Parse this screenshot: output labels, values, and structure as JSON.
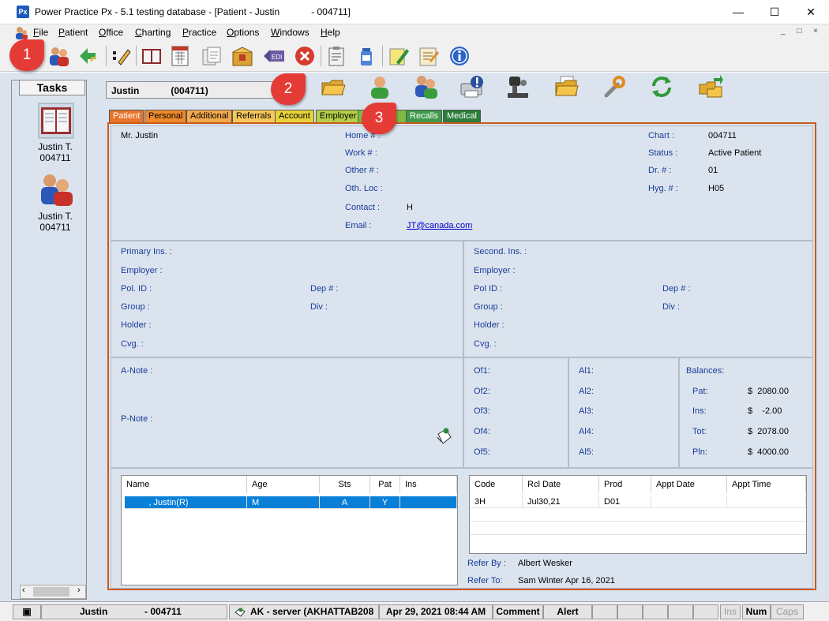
{
  "window": {
    "title": "Power Practice Px - 5.1 testing database - [Patient - Justin            - 004711]",
    "logo_text": "Px"
  },
  "menu": [
    "File",
    "Patient",
    "Office",
    "Charting",
    "Practice",
    "Options",
    "Windows",
    "Help"
  ],
  "callouts": [
    "1",
    "2",
    "3"
  ],
  "tasks": {
    "title": "Tasks",
    "items": [
      {
        "name": "Justin T.",
        "chart": "004711",
        "icon": "chart-book-icon"
      },
      {
        "name": "Justin T.",
        "chart": "004711",
        "icon": "patient-family-icon"
      }
    ]
  },
  "patient_field": "Justin            (004711)",
  "tabs": [
    {
      "label": "Patient",
      "color": "#e8742a",
      "text": "#fff",
      "active": true
    },
    {
      "label": "Personal",
      "color": "#f08a2c",
      "text": "#000"
    },
    {
      "label": "Additional",
      "color": "#f4a94c",
      "text": "#000"
    },
    {
      "label": "Referrals",
      "color": "#f6c85a",
      "text": "#000"
    },
    {
      "label": "Account",
      "color": "#e8d23a",
      "text": "#000"
    },
    {
      "label": "Employer",
      "color": "#b5cf47",
      "text": "#000"
    },
    {
      "label": "Recalls",
      "color": "#3e9a4a",
      "text": "#fff"
    },
    {
      "label": "Medical",
      "color": "#2a7d3a",
      "text": "#fff"
    }
  ],
  "patient": {
    "name": "Mr. Justin",
    "contact_labels": [
      "Home # :",
      "Work # :",
      "Other # :",
      "Oth. Loc :",
      "Contact :",
      "Email :"
    ],
    "contact_value": "H",
    "email": "JT@canada.com",
    "id_labels": [
      "Chart :",
      "Status :",
      "Dr. # :",
      "Hyg. # :"
    ],
    "id_values": [
      "004711",
      "Active Patient",
      "01",
      "H05"
    ]
  },
  "insurance": {
    "primary": [
      "Primary Ins. :",
      "Employer :",
      "Pol. ID :",
      "Group :",
      "Holder :",
      "Cvg. :"
    ],
    "primary_side": [
      "Dep # :",
      "Div :"
    ],
    "secondary": [
      "Second. Ins. :",
      "Employer :",
      "Pol ID :",
      "Group :",
      "Holder :",
      "Cvg. :"
    ],
    "secondary_side": [
      "Dep # :",
      "Div :"
    ]
  },
  "notes": {
    "a_note": "A-Note :",
    "p_note": "P-Note :"
  },
  "of_labels": [
    "Of1:",
    "Of2:",
    "Of3:",
    "Of4:",
    "Of5:"
  ],
  "al_labels": [
    "Al1:",
    "Al2:",
    "Al3:",
    "Al4:",
    "Al5:"
  ],
  "balances": {
    "title": "Balances:",
    "rows": [
      {
        "label": "Pat:",
        "value": "$  2080.00"
      },
      {
        "label": "Ins:",
        "value": "$    -2.00"
      },
      {
        "label": "Tot:",
        "value": "$  2078.00"
      },
      {
        "label": "Pln:",
        "value": "$  4000.00"
      }
    ]
  },
  "family_grid": {
    "headers": [
      "Name",
      "Age",
      "Sts",
      "Pat",
      "Ins"
    ],
    "rows": [
      [
        "        , Justin(R)",
        "M",
        "A",
        "Y",
        ""
      ]
    ]
  },
  "recall_grid": {
    "headers": [
      "Code",
      "Rcl Date",
      "Prod",
      "Appt Date",
      "Appt Time"
    ],
    "rows": [
      [
        "3H",
        "Jul30,21",
        "D01",
        "",
        ""
      ]
    ]
  },
  "referral": {
    "by_label": "Refer By :",
    "by_value": "Albert Wesker",
    "to_label": "Refer To:",
    "to_value": "Sam Winter Apr 16, 2021"
  },
  "status": {
    "patient": "Justin",
    "chart": "- 004711",
    "server": "AK - server (AKHATTAB208",
    "datetime": "Apr 29, 2021 08:44 AM",
    "comment": "Comment",
    "alert": "Alert",
    "ins": "Ins",
    "num": "Num",
    "caps": "Caps"
  }
}
